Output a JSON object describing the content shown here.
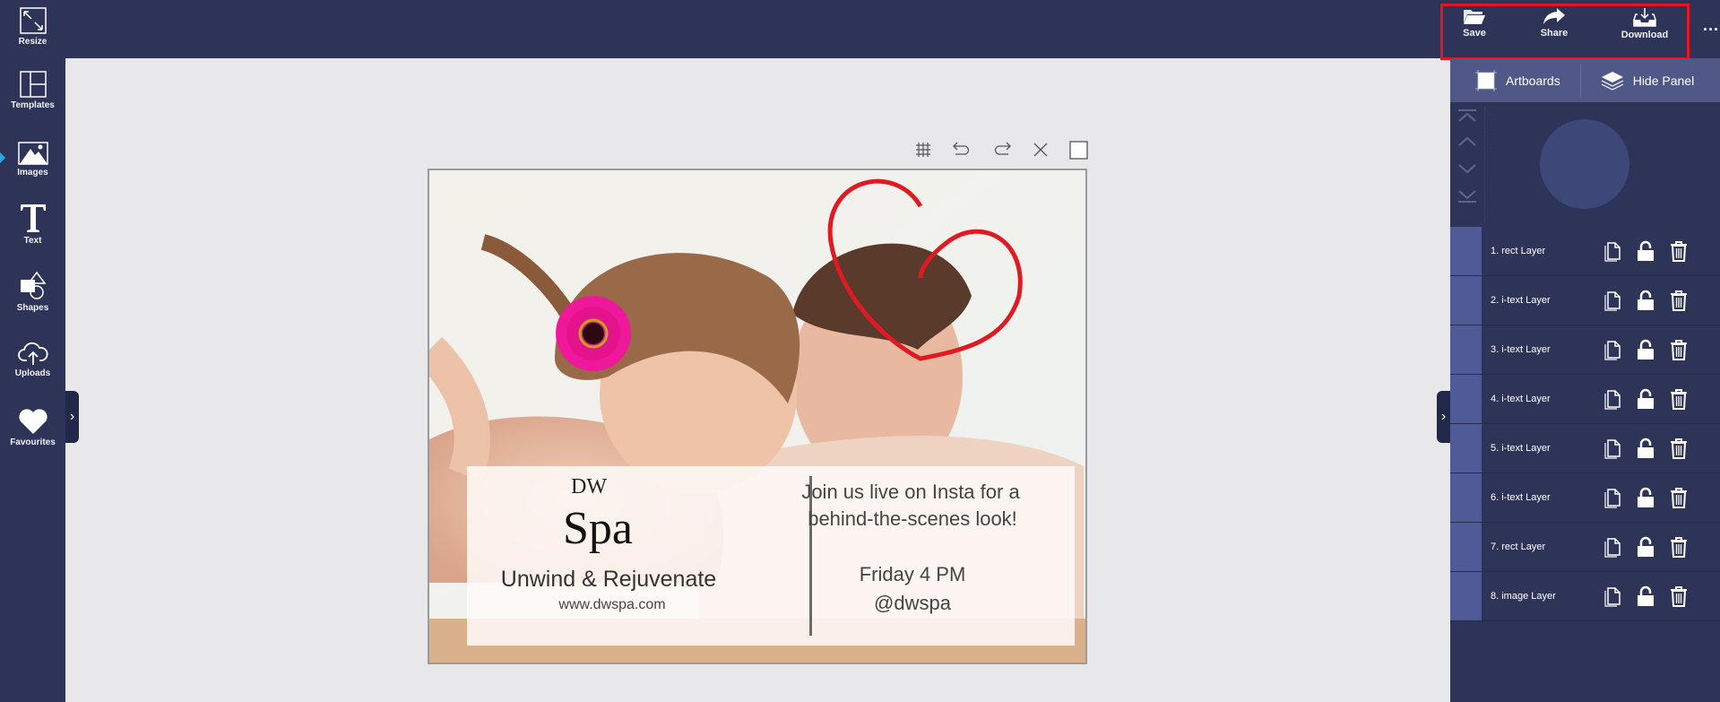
{
  "sidebar": {
    "items": [
      {
        "label": "Resize",
        "icon": "resize-icon"
      },
      {
        "label": "Templates",
        "icon": "templates-icon"
      },
      {
        "label": "Images",
        "icon": "images-icon",
        "active": true
      },
      {
        "label": "Text",
        "icon": "text-icon"
      },
      {
        "label": "Shapes",
        "icon": "shapes-icon"
      },
      {
        "label": "Uploads",
        "icon": "upload-cloud-icon"
      },
      {
        "label": "Favourites",
        "icon": "heart-icon"
      }
    ]
  },
  "toolbar": {
    "save": "Save",
    "share": "Share",
    "download": "Download",
    "more": "..."
  },
  "panel": {
    "artboards": "Artboards",
    "hide_panel": "Hide Panel",
    "layers": [
      "1. rect Layer",
      "2. i-text Layer",
      "3. i-text Layer",
      "4. i-text Layer",
      "5. i-text Layer",
      "6. i-text Layer",
      "7. rect Layer",
      "8. image Layer"
    ]
  },
  "canvas": {
    "brand_small": "DW",
    "brand_big": "Spa",
    "tagline": "Unwind & Rejuvenate",
    "website": "www.dwspa.com",
    "line1": "Join us live on Insta for a",
    "line2": "behind-the-scenes look!",
    "time": "Friday 4 PM",
    "handle": "@dwspa"
  },
  "colors": {
    "bar": "#2d3458",
    "panel_head": "#4f5887",
    "highlight": "#e8141f",
    "accent": "#29a8e0"
  }
}
